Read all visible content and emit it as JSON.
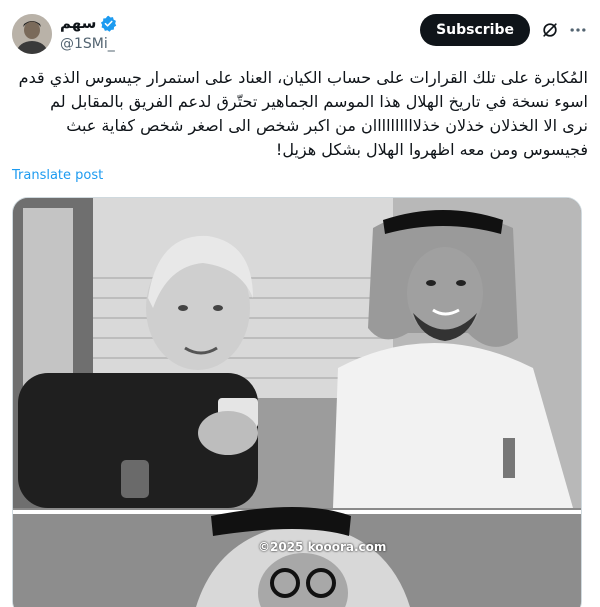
{
  "author": {
    "display_name": "سهم",
    "handle": "@1SMi_",
    "verified": true,
    "accent_color": "#1d9bf0"
  },
  "actions": {
    "subscribe_label": "Subscribe",
    "grok_icon": "grok-icon",
    "more_icon": "more-icon"
  },
  "post": {
    "lines": [
      "المُكابرة على تلك القرارات على حساب الكيان، العناد على استمرار جيسوس الذي قدم",
      "اسوء نسخة في تاريخ الهلال هذا الموسم الجماهير تحتّرق لدعم الفريق بالمقابل لم",
      "نرى الا الخذلان خذلان خذلاااااااااان من اكبر شخص الى اصغر شخص كفاية عبث",
      "فجيسوس ومن معه اظهروا الهلال بشكل هزيل!"
    ],
    "translate_label": "Translate post"
  },
  "media": {
    "watermark": "©2025 kooora.com"
  }
}
